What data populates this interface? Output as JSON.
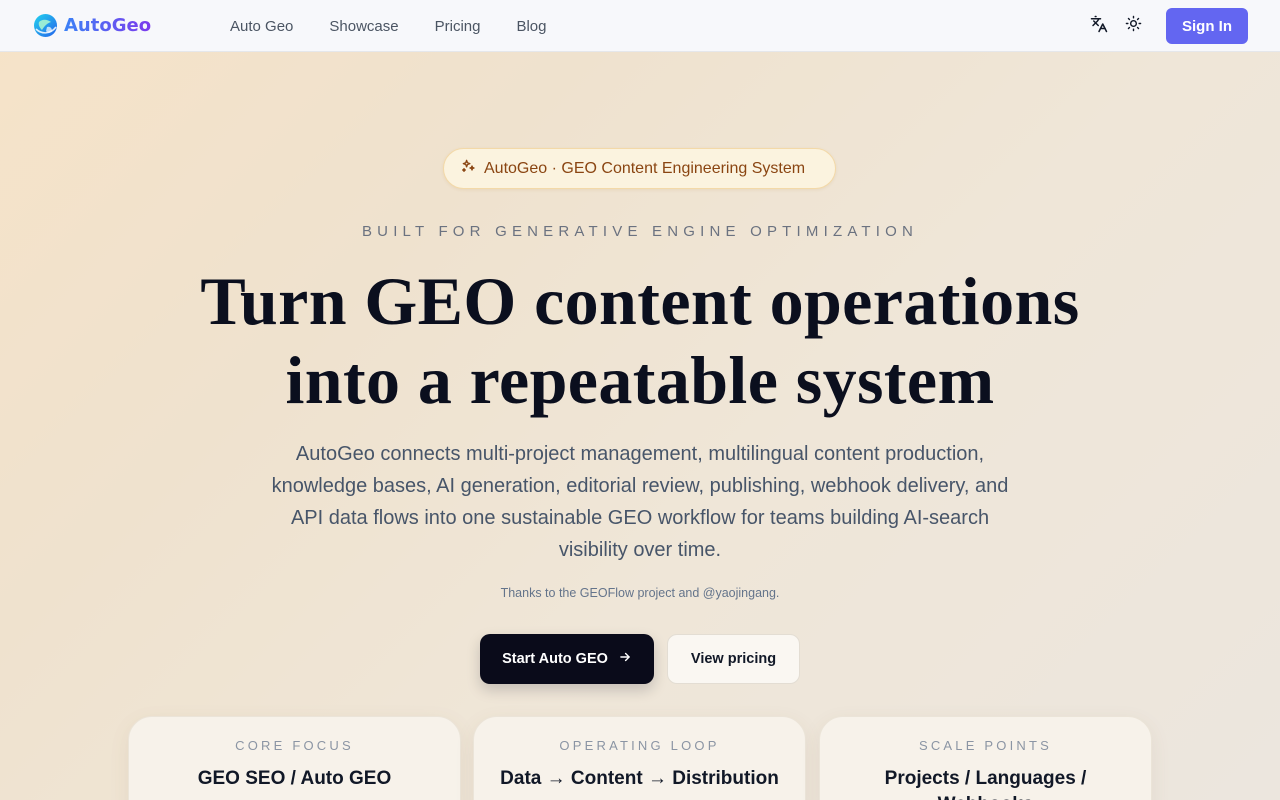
{
  "brand": {
    "name": "AutoGeo"
  },
  "nav": {
    "links": [
      "Auto Geo",
      "Showcase",
      "Pricing",
      "Blog"
    ],
    "translate_icon": "translate-icon",
    "theme_icon": "sun-icon",
    "signin_label": "Sign In"
  },
  "hero": {
    "badge_icon": "sparkles-icon",
    "badge_text": "AutoGeo · GEO Content Engineering System",
    "eyebrow": "BUILT FOR GENERATIVE ENGINE OPTIMIZATION",
    "headline_line1": "Turn GEO content operations",
    "headline_line2": "into a repeatable system",
    "subtitle": "AutoGeo connects multi-project management, multilingual content production, knowledge bases, AI generation, editorial review, publishing, webhook delivery, and API data flows into one sustainable GEO workflow for teams building AI-search visibility over time.",
    "thanks": "Thanks to the GEOFlow project and @yaojingang.",
    "cta_primary": "Start Auto GEO",
    "cta_primary_icon": "arrow-right-icon",
    "cta_secondary": "View pricing"
  },
  "cards": [
    {
      "label": "CORE FOCUS",
      "value": "GEO SEO / Auto GEO"
    },
    {
      "label": "OPERATING LOOP",
      "value": "Data → Content → Distribution"
    },
    {
      "label": "SCALE POINTS",
      "value": "Projects / Languages / Webhooks"
    }
  ],
  "colors": {
    "accent": "#6366f1",
    "dark_button": "#0a0b1a",
    "badge_text": "#8a4512"
  }
}
